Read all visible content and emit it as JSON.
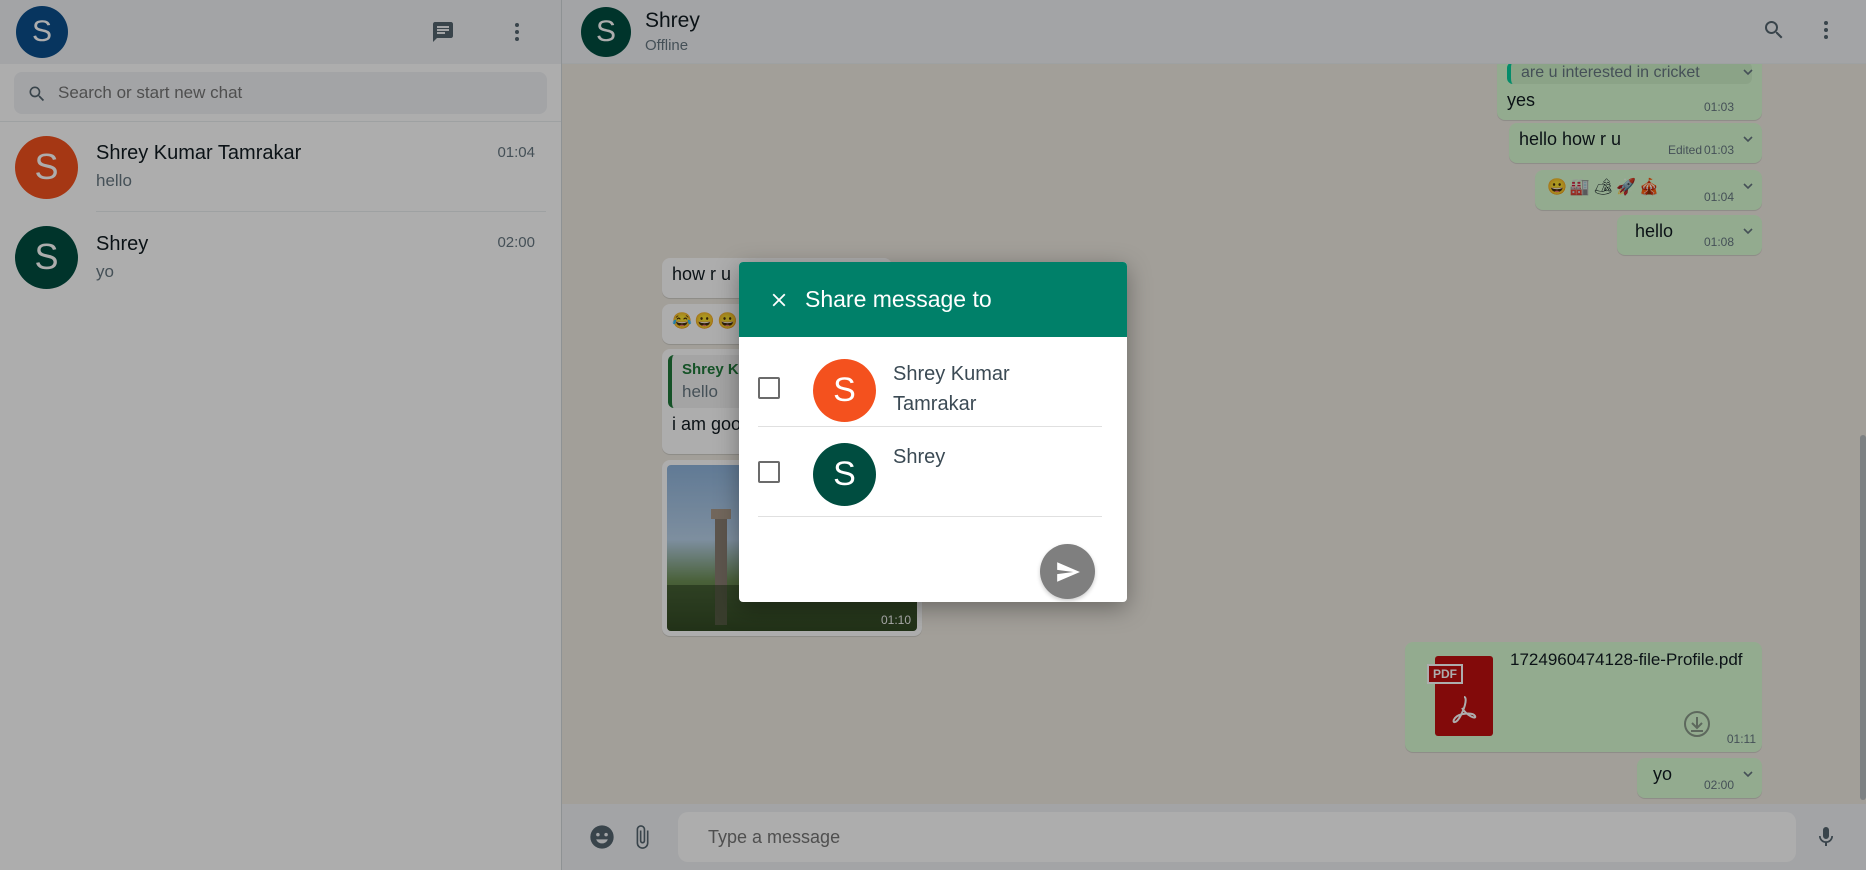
{
  "colors": {
    "accent": "#008069",
    "avatar_blue": "#0b4f8c",
    "avatar_orange": "#f4511e",
    "avatar_dark_green": "#004d40",
    "outgoing_bubble": "#d9fdd3",
    "incoming_bubble": "#ffffff",
    "overlay": "rgba(0,0,0,0.32)"
  },
  "sidebar": {
    "user_avatar_letter": "S",
    "icons": [
      "chat-icon",
      "menu-icon"
    ],
    "search": {
      "placeholder": "Search or start new chat",
      "icon": "search-icon"
    },
    "chats": [
      {
        "avatar_letter": "S",
        "name": "Shrey Kumar Tamrakar",
        "last_message": "hello",
        "time": "01:04"
      },
      {
        "avatar_letter": "S",
        "name": "Shrey",
        "last_message": "yo",
        "time": "02:00"
      }
    ]
  },
  "conversation": {
    "header": {
      "avatar_letter": "S",
      "name": "Shrey",
      "status": "Offline",
      "icons": [
        "search-icon",
        "menu-icon"
      ]
    },
    "messages": {
      "m1_reply_partial": "are u interested in cricket",
      "m1_text": "yes",
      "m1_time": "01:03",
      "m2_text": "hello how r u",
      "m2_edited": "Edited",
      "m2_time": "01:03",
      "m3_emojis": [
        "😀",
        "🏭",
        "🏕",
        "🚀",
        "🎪"
      ],
      "m3_time": "01:04",
      "m4_text": "hello",
      "m4_time": "01:08",
      "m5_text": "how r u",
      "m6_emojis": [
        "😂",
        "😀",
        "😀"
      ],
      "m7_reply_name": "Shrey K",
      "m7_reply_text": "hello",
      "m7_text": "i am goo",
      "m8_time": "01:10",
      "m9_filename": "1724960474128-file-Profile.pdf",
      "m9_badge": "PDF",
      "m9_time": "01:11",
      "m10_text": "yo",
      "m10_time": "02:00"
    },
    "compose": {
      "placeholder": "Type a message",
      "icons": [
        "emoji-icon",
        "attach-icon",
        "mic-icon"
      ]
    }
  },
  "dialog": {
    "title": "Share message to",
    "close_icon": "close-icon",
    "contacts": [
      {
        "avatar_letter": "S",
        "name": "Shrey Kumar Tamrakar",
        "checked": false
      },
      {
        "avatar_letter": "S",
        "name": "Shrey",
        "checked": false
      }
    ],
    "send_icon": "send-icon"
  }
}
